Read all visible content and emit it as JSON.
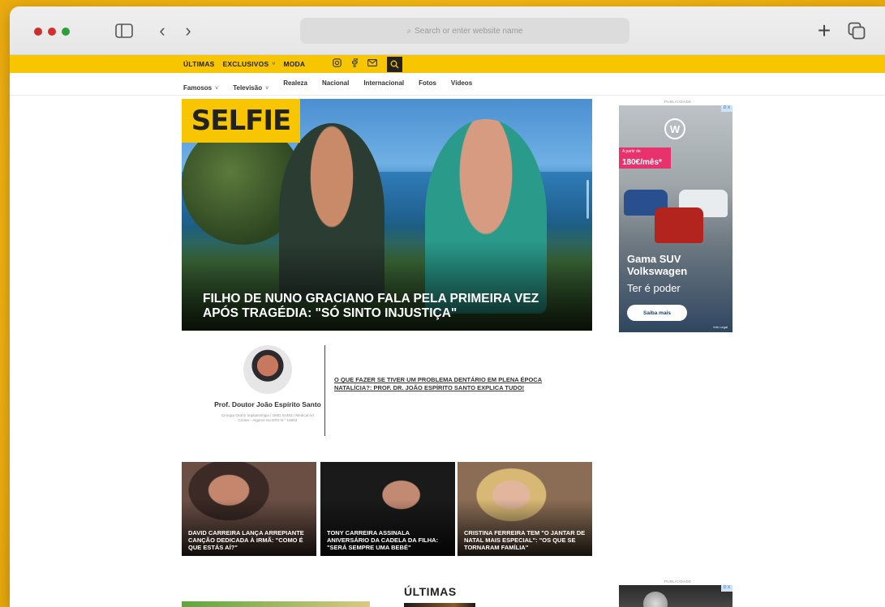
{
  "browser": {
    "url_placeholder": "Search or enter website name"
  },
  "nav": {
    "top_items": [
      {
        "label": "ÚLTIMAS"
      },
      {
        "label": "EXCLUSIVOS"
      },
      {
        "label": "MODA"
      }
    ],
    "sub_items": [
      {
        "label": "Famosos"
      },
      {
        "label": "Televisão"
      },
      {
        "label": "Realeza"
      },
      {
        "label": "Nacional"
      },
      {
        "label": "Internacional"
      },
      {
        "label": "Fotos"
      },
      {
        "label": "Vídeos"
      }
    ],
    "caret": "˅"
  },
  "hero": {
    "logo": "SELFIE",
    "title": "FILHO DE NUNO GRACIANO FALA PELA PRIMEIRA VEZ APÓS TRAGÉDIA: \"SÓ SINTO INJUSTIÇA\""
  },
  "ads": {
    "label": "PUBLICIDADE",
    "vw": {
      "price_prefix": "A partir de",
      "price": "180€/mês*",
      "headline_line1": "Gama SUV",
      "headline_line2": "Volkswagen",
      "tagline": "Ter é poder",
      "cta": "Saiba mais",
      "legal": "Info Legal"
    },
    "adchoice": "D X"
  },
  "sponsored": {
    "name": "Prof. Doutor João Espírito Santo",
    "subtitle": "Cirurgia Oral E Implantologia / OMD 04483 / Medical Art Center - Algarve Nu ERS N.º 18963",
    "headline": "O QUE FAZER SE TIVER UM PROBLEMA DENTÁRIO EM PLENA ÉPOCA NATALÍCIA?: PROF. DR. JOÃO ESPÍRITO SANTO EXPLICA TUDO!"
  },
  "cards": [
    {
      "title": "DAVID CARREIRA LANÇA ARREPIANTE CANÇÃO DEDICADA À IRMÃ: \"COMO É QUE ESTÁS AÍ?\""
    },
    {
      "title": "TONY CARREIRA ASSINALA ANIVERSÁRIO DA CADELA DA FILHA: \"SERÁ SEMPRE UMA BEBÉ\""
    },
    {
      "title": "CRISTINA FERREIRA TEM \"O JANTAR DE NATAL MAIS ESPECIAL\": \"OS QUE SE TORNARAM FAMÍLIA\""
    }
  ],
  "section": {
    "ultimas": "ÚLTIMAS"
  }
}
